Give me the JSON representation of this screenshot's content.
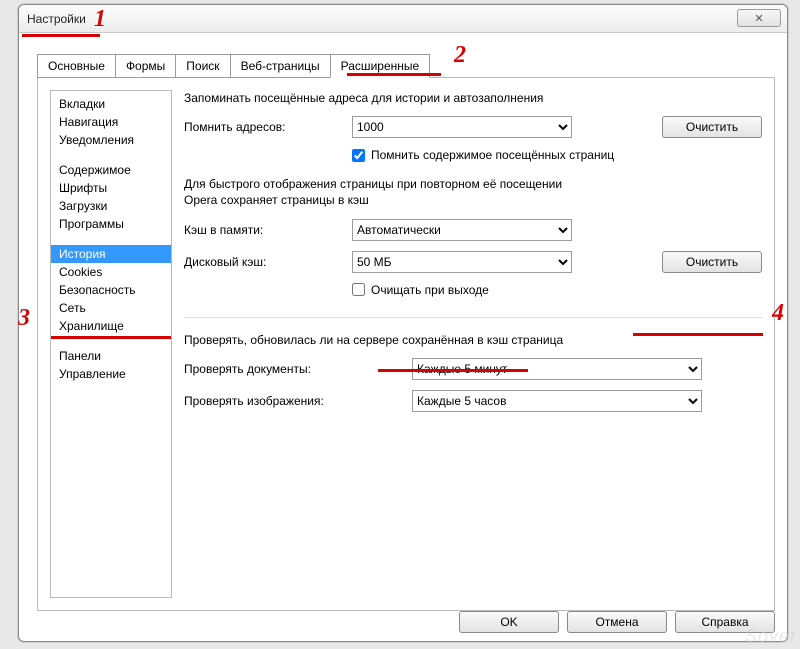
{
  "window": {
    "title": "Настройки",
    "close": "✕"
  },
  "tabs": {
    "items": [
      "Основные",
      "Формы",
      "Поиск",
      "Веб-страницы",
      "Расширенные"
    ],
    "active_index": 4
  },
  "sidebar": {
    "groups": [
      [
        "Вкладки",
        "Навигация",
        "Уведомления"
      ],
      [
        "Содержимое",
        "Шрифты",
        "Загрузки",
        "Программы"
      ],
      [
        "История",
        "Cookies",
        "Безопасность",
        "Сеть",
        "Хранилище"
      ],
      [
        "Панели",
        "Управление"
      ]
    ],
    "selected": "История"
  },
  "main": {
    "intro": "Запоминать посещённые адреса для истории и автозаполнения",
    "remember_addresses_label": "Помнить адресов:",
    "remember_addresses_value": "1000",
    "clear_button": "Очистить",
    "remember_content_checkbox_label": "Помнить содержимое посещённых страниц",
    "remember_content_checked": true,
    "cache_explain_line1": "Для быстрого отображения страницы при повторном её посещении",
    "cache_explain_line2": "Opera сохраняет страницы в кэш",
    "mem_cache_label": "Кэш в памяти:",
    "mem_cache_value": "Автоматически",
    "disk_cache_label": "Дисковый кэш:",
    "disk_cache_value": "50 МБ",
    "clear_on_exit_label": "Очищать при выходе",
    "clear_on_exit_checked": false,
    "divider_text": "Проверять, обновилась ли на сервере сохранённая в кэш страница",
    "check_docs_label": "Проверять документы:",
    "check_docs_value": "Каждые 5 минут",
    "check_images_label": "Проверять изображения:",
    "check_images_value": "Каждые 5 часов"
  },
  "footer": {
    "ok": "OK",
    "cancel": "Отмена",
    "help": "Справка"
  },
  "annotations": {
    "n1": "1",
    "n2": "2",
    "n3": "3",
    "n4": "4"
  }
}
